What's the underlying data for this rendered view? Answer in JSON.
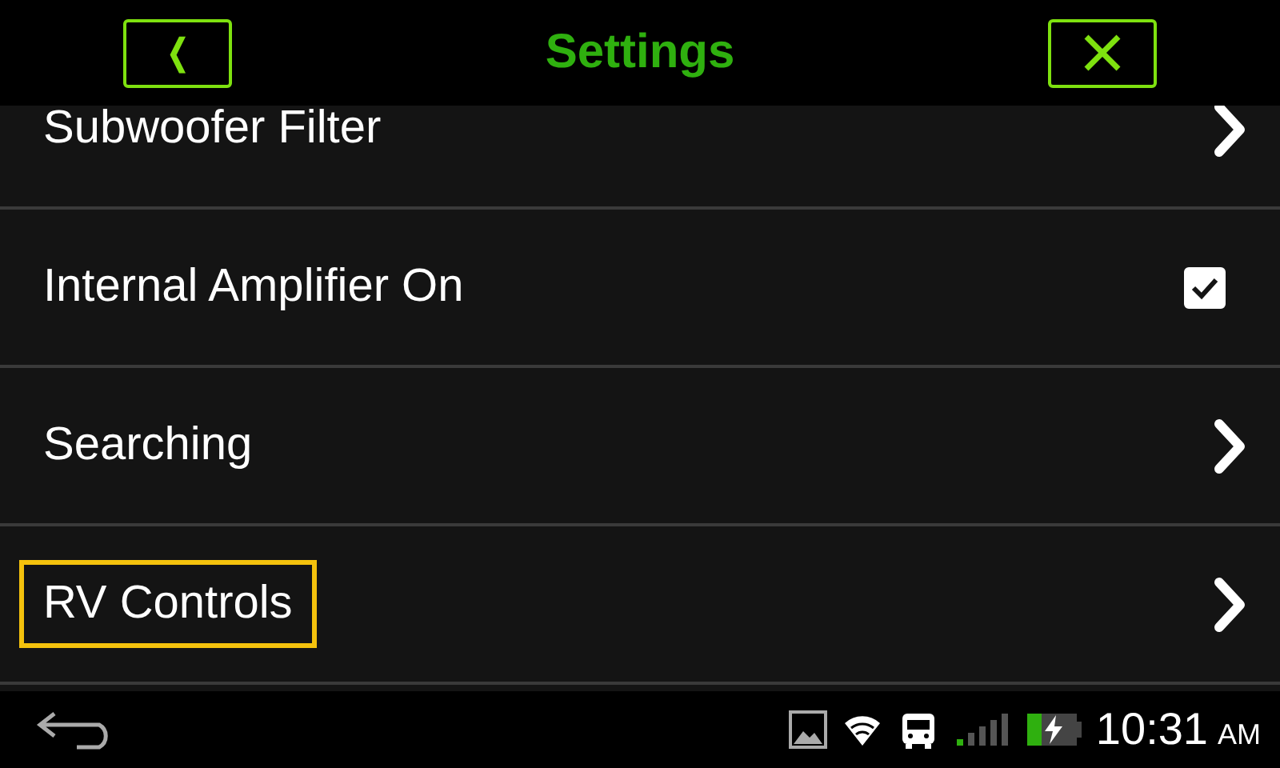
{
  "header": {
    "back_label": "❬",
    "title": "Settings"
  },
  "items": [
    {
      "kind": "link",
      "label": "Subwoofer Filter",
      "focused": false
    },
    {
      "kind": "checkbox",
      "label": "Internal Amplifier On",
      "checked": true,
      "focused": false
    },
    {
      "kind": "link",
      "label": "Searching",
      "focused": false
    },
    {
      "kind": "link",
      "label": "RV Controls",
      "focused": true
    }
  ],
  "status_bar": {
    "time": "10:31",
    "meridiem": "AM"
  }
}
